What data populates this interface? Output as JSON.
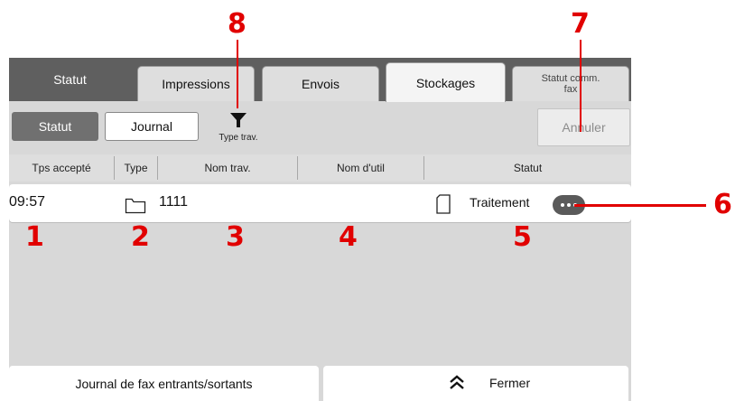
{
  "tabs": {
    "status": "Statut",
    "prints": "Impressions",
    "sends": "Envois",
    "storages": "Stockages",
    "fax_comm_line1": "Statut comm.",
    "fax_comm_line2": "fax"
  },
  "toolbar": {
    "status_btn": "Statut",
    "journal_btn": "Journal",
    "job_type_filter": "Type trav.",
    "cancel_btn": "Annuler"
  },
  "table": {
    "headers": [
      "Tps accepté",
      "Type",
      "Nom trav.",
      "Nom d'util",
      "Statut"
    ],
    "rows": [
      {
        "time": "09:57",
        "type_icon": "folder-icon",
        "job_name": "1111",
        "user_name": "",
        "status_icon": "document-icon",
        "status": "Traitement"
      }
    ]
  },
  "footer": {
    "fax_log": "Journal de fax entrants/sortants",
    "close": "Fermer"
  },
  "callouts": [
    "1",
    "2",
    "3",
    "4",
    "5",
    "6",
    "7",
    "8"
  ],
  "colors": {
    "callout": "#e10000",
    "tabbar": "#5f5f5f",
    "panel": "#d8d8d8",
    "active_tab": "#f2f2f2"
  }
}
